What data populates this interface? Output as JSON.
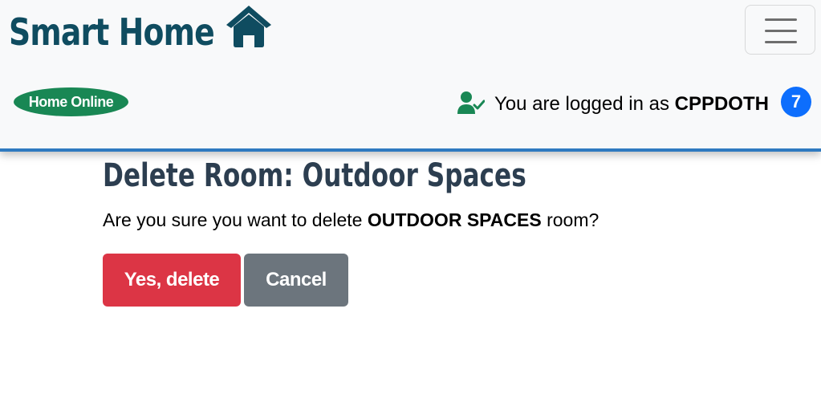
{
  "header": {
    "brand": "Smart Home",
    "brand_icon": "house-icon",
    "menu_icon": "hamburger-menu-icon",
    "status": "Home Online",
    "status_color": "#198754",
    "login_prefix": "You are logged in as ",
    "username": "CPPDOTH",
    "user_icon": "user-check-icon",
    "notification_count": "7",
    "accent_color": "#2f7ac0"
  },
  "main": {
    "title": "Delete Room: Outdoor Spaces",
    "confirm_prefix": "Are you sure you want to delete ",
    "room_name": "OUTDOOR SPACES",
    "confirm_suffix": " room?",
    "delete_label": "Yes, delete",
    "delete_color": "#dc3545",
    "cancel_label": "Cancel",
    "cancel_color": "#6c757d"
  }
}
